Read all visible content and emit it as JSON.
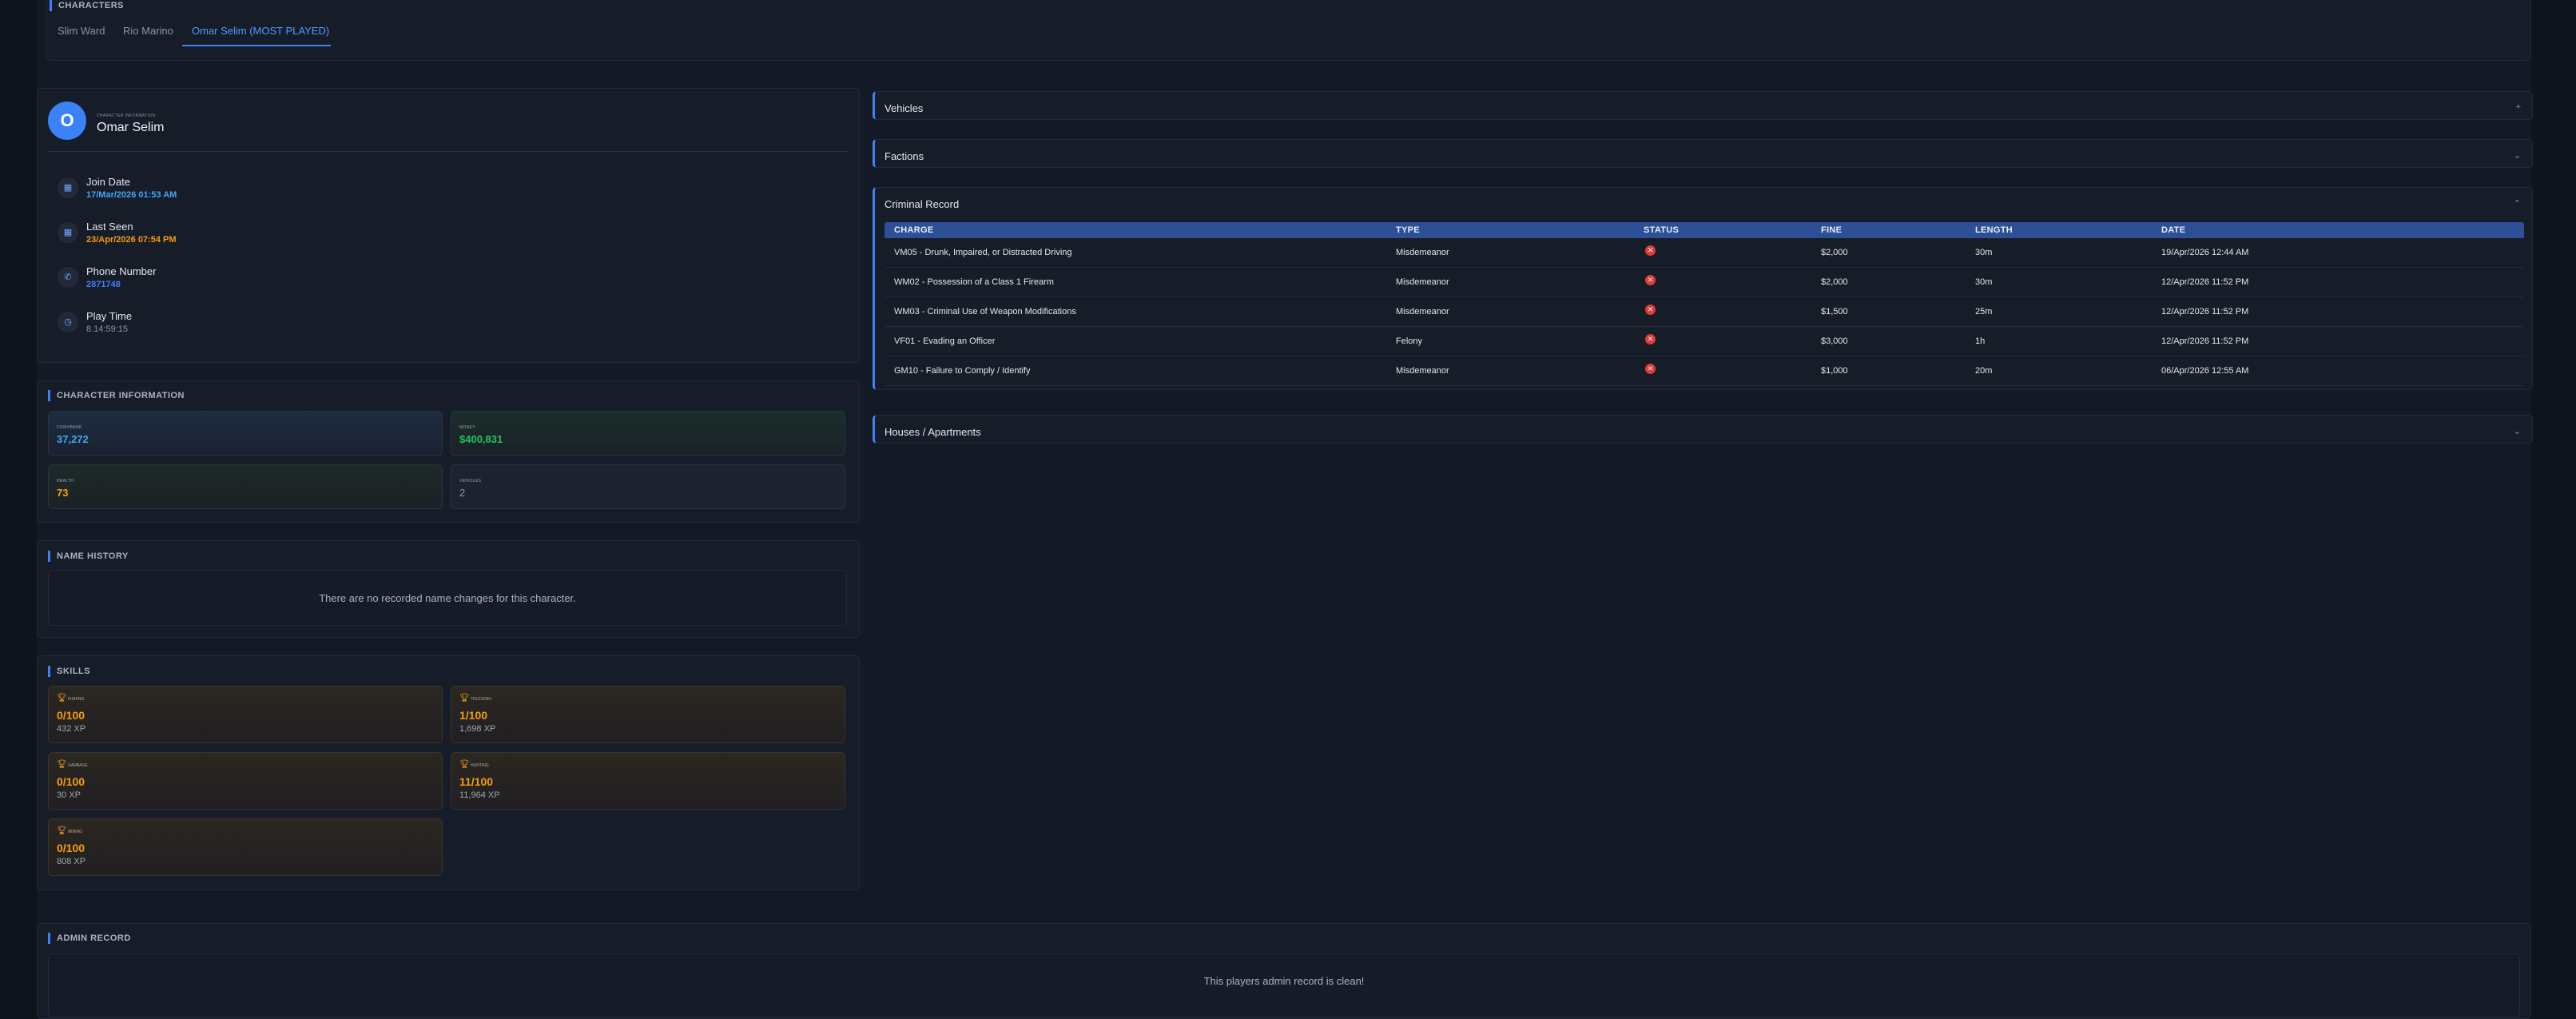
{
  "characters": {
    "section_title": "CHARACTERS",
    "tabs": [
      {
        "label": "Slim Ward"
      },
      {
        "label": "Rio Marino"
      },
      {
        "label": "Omar Selim (MOST PLAYED)"
      }
    ]
  },
  "profile": {
    "avatar_letter": "O",
    "small_label": "CHARACTER INFORMATION",
    "name": "Omar Selim",
    "items": [
      {
        "label": "Join Date",
        "value": "17/Mar/2026 01:53 AM",
        "icon": "calendar-icon",
        "color": "#3da9f5"
      },
      {
        "label": "Last Seen",
        "value": "23/Apr/2026 07:54 PM",
        "icon": "calendar-icon",
        "color": "#f59e0b"
      },
      {
        "label": "Phone Number",
        "value": "2871748",
        "icon": "phone-icon",
        "color": "#3b82f6"
      },
      {
        "label": "Play Time",
        "value": "8.14:59:15",
        "icon": "clock-icon",
        "color": "#8b93a5"
      }
    ]
  },
  "character_info": {
    "title": "CHARACTER INFORMATION",
    "stats": [
      {
        "label": "CASH/BANK",
        "value": "37,272",
        "color": "#3da9f5"
      },
      {
        "label": "MONEY",
        "value": "$400,831",
        "color": "#22c55e"
      },
      {
        "label": "HEALTH",
        "value": "73",
        "color": "#f59e0b"
      },
      {
        "label": "VEHICLES",
        "value": "2",
        "color": "#8b93a5"
      }
    ]
  },
  "name_history": {
    "title": "NAME HISTORY",
    "empty_text": "There are no recorded name changes for this character."
  },
  "skills": {
    "title": "SKILLS",
    "items": [
      {
        "name": "FISHING",
        "level": "0/100",
        "xp": "432 XP"
      },
      {
        "name": "TRUCKING",
        "level": "1/100",
        "xp": "1,698 XP"
      },
      {
        "name": "GARBAGE",
        "level": "0/100",
        "xp": "30 XP"
      },
      {
        "name": "HUNTING",
        "level": "11/100",
        "xp": "11,964 XP"
      },
      {
        "name": "MINING",
        "level": "0/100",
        "xp": "808 XP"
      }
    ]
  },
  "accordions": {
    "vehicles": {
      "title": "Vehicles",
      "chevron": "+"
    },
    "factions": {
      "title": "Factions",
      "chevron": "⌄"
    },
    "criminal_record": {
      "title": "Criminal Record",
      "chevron": "⌃"
    },
    "houses": {
      "title": "Houses / Apartments",
      "chevron": "⌄"
    }
  },
  "criminal_record": {
    "columns": [
      "CHARGE",
      "TYPE",
      "STATUS",
      "FINE",
      "LENGTH",
      "DATE"
    ],
    "rows": [
      {
        "charge": "VM05 - Drunk, Impaired, or Distracted Driving",
        "type": "Misdemeanor",
        "fine": "$2,000",
        "length": "30m",
        "date": "19/Apr/2026 12:44 AM"
      },
      {
        "charge": "WM02 - Possession of a Class 1 Firearm",
        "type": "Misdemeanor",
        "fine": "$2,000",
        "length": "30m",
        "date": "12/Apr/2026 11:52 PM"
      },
      {
        "charge": "WM03 - Criminal Use of Weapon Modifications",
        "type": "Misdemeanor",
        "fine": "$1,500",
        "length": "25m",
        "date": "12/Apr/2026 11:52 PM"
      },
      {
        "charge": "VF01 - Evading an Officer",
        "type": "Felony",
        "fine": "$3,000",
        "length": "1h",
        "date": "12/Apr/2026 11:52 PM"
      },
      {
        "charge": "GM10 - Failure to Comply / Identify",
        "type": "Misdemeanor",
        "fine": "$1,000",
        "length": "20m",
        "date": "06/Apr/2026 12:55 AM"
      }
    ]
  },
  "admin_record": {
    "title": "ADMIN RECORD",
    "empty_text": "This players admin record is clean!"
  },
  "colors": {
    "accent": "#3b82f6",
    "header_row": "#2d4f95",
    "danger": "#e23b3b",
    "skill_level": "#f59e0b"
  }
}
